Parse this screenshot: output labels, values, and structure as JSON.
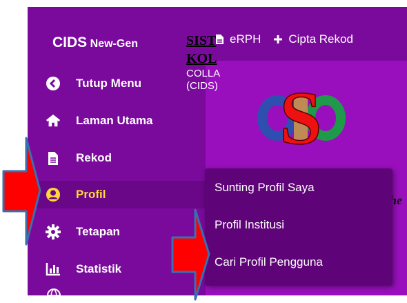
{
  "brand": {
    "name": "CIDS",
    "edition": "New-Gen"
  },
  "topbar": {
    "items": [
      {
        "label": "eRPH",
        "icon": "document-icon"
      },
      {
        "label": "Cipta Rekod",
        "icon": "plus-icon"
      }
    ]
  },
  "sidebar": {
    "items": [
      {
        "label": "Tutup Menu",
        "icon": "chevron-left-circle-icon"
      },
      {
        "label": "Laman Utama",
        "icon": "home-icon"
      },
      {
        "label": "Rekod",
        "icon": "document-icon"
      },
      {
        "label": "Profil",
        "icon": "user-circle-icon",
        "active": true
      },
      {
        "label": "Tetapan",
        "icon": "gear-icon"
      },
      {
        "label": "Statistik",
        "icon": "bar-chart-icon"
      }
    ]
  },
  "main": {
    "title_line1": "SIST",
    "title_line2": "KOL",
    "subtitle_line1": "COLLA",
    "subtitle_line2": "(CIDS)",
    "italic_fragment": "he"
  },
  "dropdown": {
    "items": [
      {
        "label": "Sunting Profil Saya"
      },
      {
        "label": "Profil Institusi"
      },
      {
        "label": "Cari Profil Pengguna"
      }
    ]
  },
  "colors": {
    "sidebar_bg": "#7a0a9c",
    "content_bg": "#9a0fbd",
    "active_text": "#ffd93a",
    "dropdown_bg": "#5e0478",
    "arrow_red": "#ff0000",
    "arrow_outline": "#3a6fb0"
  }
}
